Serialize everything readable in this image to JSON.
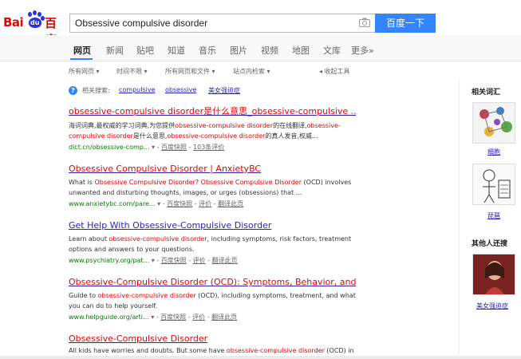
{
  "brand": {
    "logo_left": "Bai",
    "logo_paw": "du",
    "logo_right": "百度",
    "color_red": "#e10602",
    "color_blue": "#2932e1"
  },
  "search": {
    "value": "Obsessive compulsive disorder",
    "button_label": "百度一下"
  },
  "tabs": [
    {
      "label": "网页",
      "active": true
    },
    {
      "label": "新闻"
    },
    {
      "label": "贴吧"
    },
    {
      "label": "知道"
    },
    {
      "label": "音乐"
    },
    {
      "label": "图片"
    },
    {
      "label": "视频"
    },
    {
      "label": "地图"
    },
    {
      "label": "文库"
    },
    {
      "label": "更多»"
    }
  ],
  "filters": {
    "all_pages": "所有网页 ▾",
    "time": "时间不限 ▾",
    "file_type": "所有网页和文件 ▾",
    "site": "站点内检索 ▾",
    "tools": "◂ 收起工具"
  },
  "related_search": {
    "label": "相关搜索:",
    "items": [
      "compulsive",
      "obsessive",
      "美女强迫症"
    ]
  },
  "results": [
    {
      "title_a": "obsessive-compulsive disorder是什么意思_obsessive-compulsive ...",
      "abstract_1": "海词词典,最权威的学习词典,为您提供",
      "abstract_em1": "obsessive-compulsive disorder",
      "abstract_2": "的在线翻译,",
      "abstract_em2": "obsessive-compulsive disorder",
      "abstract_3": "是什么意思,",
      "abstract_em3": "obsessive-compulsive disorder",
      "abstract_4": "的真人发音,权威...",
      "url": "dict.cn/obsessive-comp...",
      "snapshot": "百度快照",
      "extra": "103条评价"
    },
    {
      "title_a": "Obsessive Compulsive Disorder | AnxietyBC",
      "abstract_1": "What is ",
      "abstract_em1": "Obsessive Compulsive Disorder",
      "abstract_2": "? ",
      "abstract_em2": "Obsessive Compulsive Disorder",
      "abstract_3": " (OCD) involves unwanted and disturbing thoughts, images, or urges (obsessions) that ...",
      "url": "www.anxietybc.com/pare...",
      "snapshot": "百度快照",
      "extra": "评价",
      "translate": "翻译此页"
    },
    {
      "title_a": "Get Help With Obsessive-Compulsive Disorder",
      "abstract_1": "Learn about ",
      "abstract_em1": "obsessive-compulsive disorder",
      "abstract_2": ", including symptoms, risk factors, treatment options and answers to your questions.",
      "url": "www.psychiatry.org/pat...",
      "snapshot": "百度快照",
      "extra": "评价",
      "translate": "翻译此页"
    },
    {
      "title_a": "Obsessive-Compulsive Disorder (OCD): Symptoms, Behavior, and ...",
      "abstract_1": "Guide to ",
      "abstract_em1": "obsessive-compulsive disorder",
      "abstract_2": " (OCD), including symptoms, treatment, and what you can do to help yourself.",
      "url": "www.helpguide.org/arti...",
      "snapshot": "百度快照",
      "extra": "评价",
      "translate": "翻译此页"
    },
    {
      "title_a": "Obsessive-Compulsive Disorder",
      "abstract_1": "All kids have worries and doubts. But some have ",
      "abstract_em1": "obsessive-compulsive disorder",
      "abstract_2": " (OCD) in"
    }
  ],
  "right_panel": {
    "related_heading": "相关词汇",
    "related_items": [
      "细胞",
      "琵琶"
    ],
    "others_heading": "其他人还搜",
    "others_items": [
      "美女强迫症"
    ]
  }
}
